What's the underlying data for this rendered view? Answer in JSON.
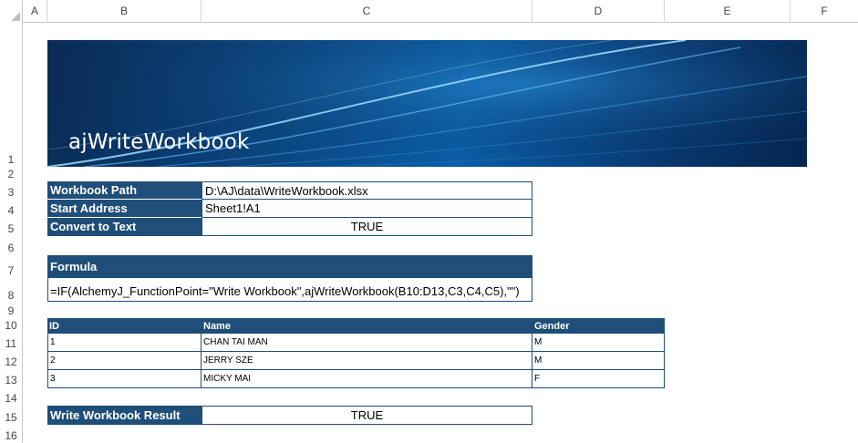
{
  "sheet": {
    "column_headers": [
      "A",
      "B",
      "C",
      "D",
      "E",
      "F"
    ],
    "row_headers": [
      "1",
      "2",
      "3",
      "4",
      "5",
      "6",
      "7",
      "8",
      "9",
      "10",
      "11",
      "12",
      "13",
      "14",
      "15",
      "16"
    ]
  },
  "banner": {
    "title": "ajWriteWorkbook"
  },
  "params": {
    "workbook_path_label": "Workbook Path",
    "workbook_path_value": "D:\\AJ\\data\\WriteWorkbook.xlsx",
    "start_address_label": "Start Address",
    "start_address_value": "Sheet1!A1",
    "convert_to_text_label": "Convert to Text",
    "convert_to_text_value": "TRUE"
  },
  "formula": {
    "label": "Formula",
    "text": "=IF(AlchemyJ_FunctionPoint=\"Write Workbook\",ajWriteWorkbook(B10:D13,C3,C4,C5),\"\")"
  },
  "data_table": {
    "headers": [
      "ID",
      "Name",
      "Gender"
    ],
    "rows": [
      [
        "1",
        "CHAN TAI MAN",
        "M"
      ],
      [
        "2",
        "JERRY SZE",
        "M"
      ],
      [
        "3",
        "MICKY MAI",
        "F"
      ]
    ]
  },
  "result": {
    "label": "Write Workbook Result",
    "value": "TRUE"
  },
  "colors": {
    "header_fill": "#1f4e79",
    "grid": "#d4d4d4"
  }
}
